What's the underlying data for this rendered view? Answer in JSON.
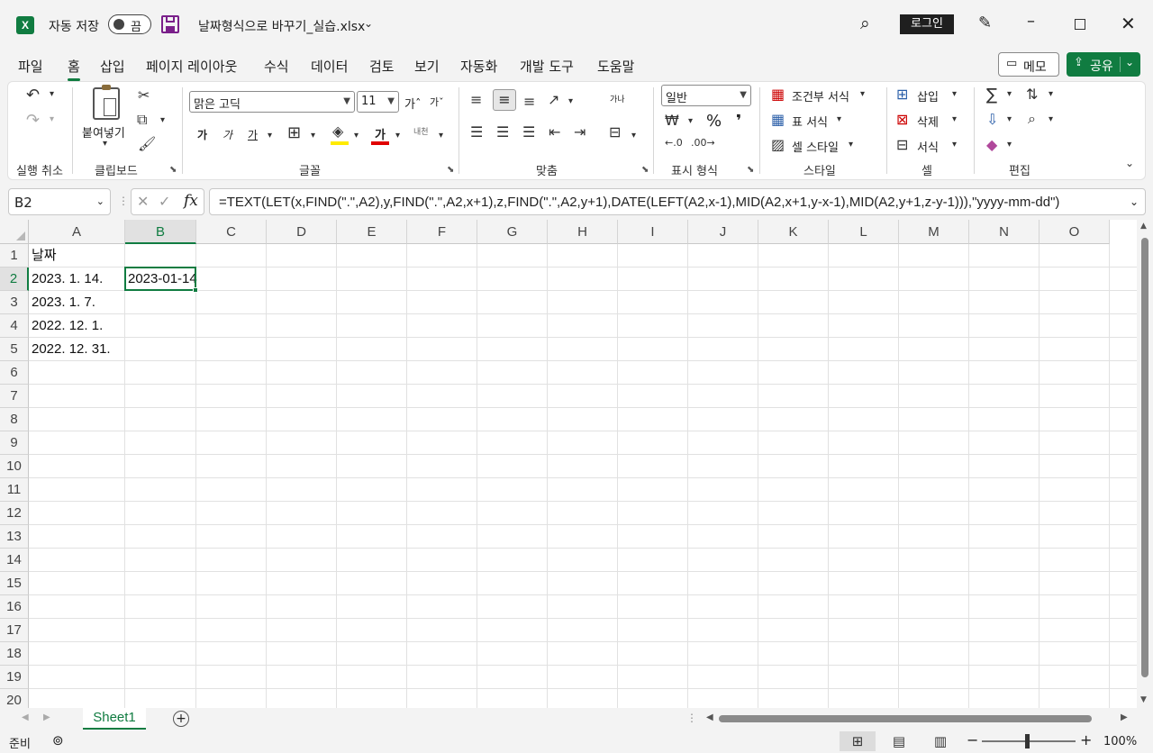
{
  "titlebar": {
    "app_icon": "X",
    "autosave_label": "자동 저장",
    "autosave_state": "끔",
    "filename": "날짜형식으로 바꾸기_실습.xlsx",
    "login_label": "로그인"
  },
  "menu": {
    "tabs": [
      "파일",
      "홈",
      "삽입",
      "페이지 레이아웃",
      "수식",
      "데이터",
      "검토",
      "보기",
      "자동화",
      "개발 도구",
      "도움말"
    ],
    "active_index": 1,
    "memo_label": "메모",
    "share_label": "공유"
  },
  "ribbon": {
    "groups": {
      "undo": "실행 취소",
      "clipboard": "클립보드",
      "font": "글꼴",
      "alignment": "맞춤",
      "number": "표시 형식",
      "styles": "스타일",
      "cells": "셀",
      "editing": "편집"
    },
    "paste_label": "붙여넣기",
    "font_name": "맑은 고딕",
    "font_size": "11",
    "number_format": "일반",
    "bold_glyph": "가",
    "italic_glyph": "가",
    "underline_glyph": "가",
    "font_color_glyph": "가",
    "phonetic_glyph": "내천",
    "increase_font": "가ˆ",
    "decrease_font": "가ˇ",
    "wrap_text_glyph": "가나",
    "percent_glyph": "%",
    "comma_glyph": "❜",
    "conditional_format": "조건부 서식",
    "format_as_table": "표 서식",
    "cell_styles": "셀 스타일",
    "insert": "삽입",
    "delete": "삭제",
    "format": "서식"
  },
  "formula_bar": {
    "name_box": "B2",
    "formula": "=TEXT(LET(x,FIND(\".\",A2),y,FIND(\".\",A2,x+1),z,FIND(\".\",A2,y+1),DATE(LEFT(A2,x-1),MID(A2,x+1,y-x-1),MID(A2,y+1,z-y-1))),\"yyyy-mm-dd\")"
  },
  "sheet": {
    "columns": [
      "A",
      "B",
      "C",
      "D",
      "E",
      "F",
      "G",
      "H",
      "I",
      "J",
      "K",
      "L",
      "M",
      "N",
      "O"
    ],
    "rows": [
      "1",
      "2",
      "3",
      "4",
      "5",
      "6",
      "7",
      "8",
      "9",
      "10",
      "11",
      "12",
      "13",
      "14",
      "15",
      "16",
      "17",
      "18",
      "19",
      "20"
    ],
    "selected_cell": "B2",
    "cells": {
      "A1": "날짜",
      "A2": "2023. 1. 14.",
      "A3": "2023. 1. 7.",
      "A4": "2022. 12. 1.",
      "A5": "2022. 12. 31.",
      "B2": "2023-01-14"
    }
  },
  "tabs": {
    "sheets": [
      "Sheet1"
    ],
    "active": "Sheet1"
  },
  "status": {
    "mode": "준비",
    "zoom": "100%"
  },
  "colors": {
    "accent": "#107c41",
    "header_bg": "#f3f3f3",
    "gridline": "#e1e1e1"
  }
}
